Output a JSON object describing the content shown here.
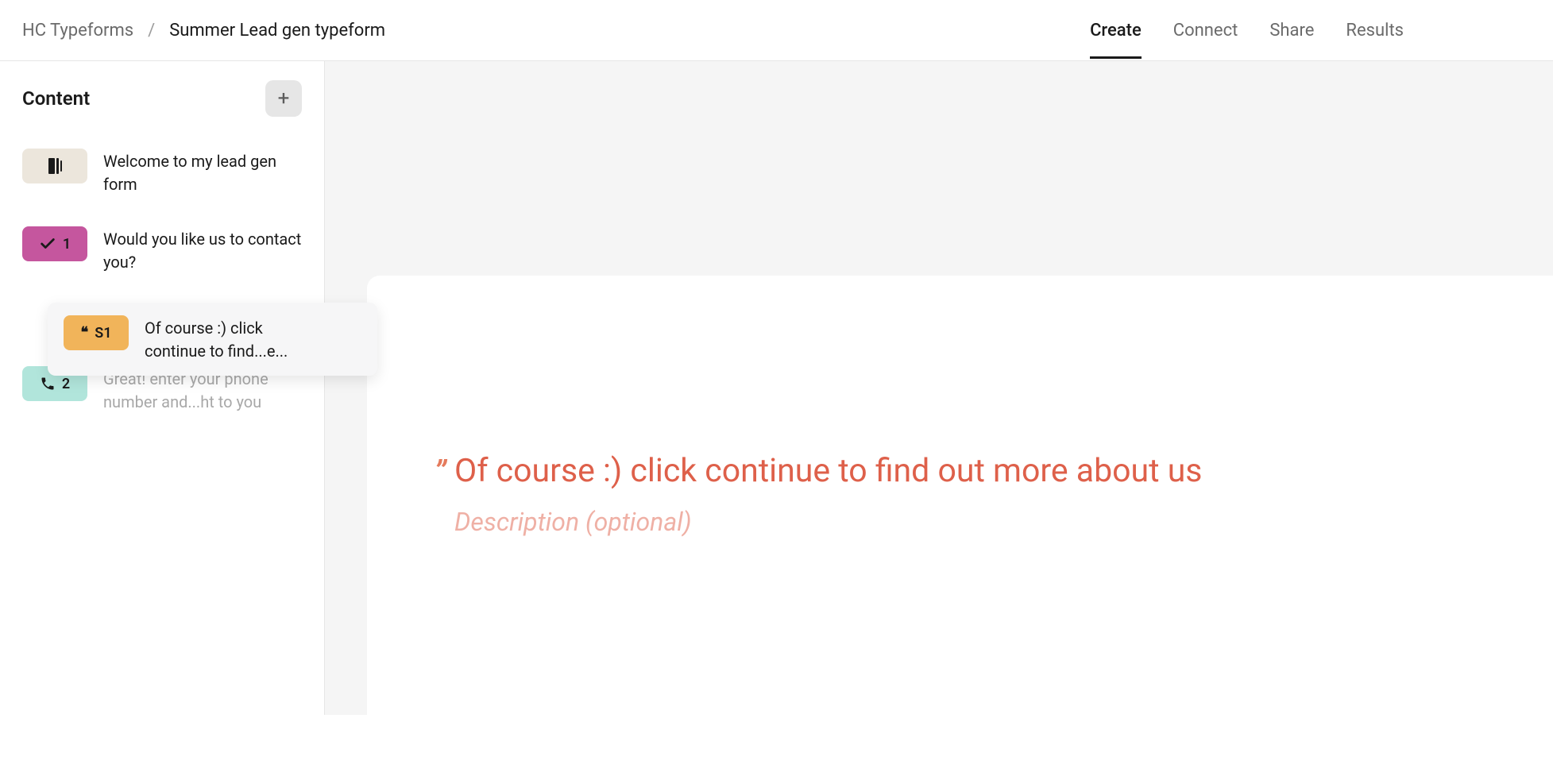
{
  "header": {
    "workspace": "HC Typeforms",
    "separator": "/",
    "form_title": "Summer Lead gen typeform",
    "tabs": {
      "create": "Create",
      "connect": "Connect",
      "share": "Share",
      "results": "Results"
    },
    "active_tab": "create"
  },
  "sidebar": {
    "title": "Content",
    "add_label": "+",
    "items": [
      {
        "type": "welcome",
        "label": "Welcome to my lead gen form",
        "badge_num": ""
      },
      {
        "type": "yesno",
        "label": "Would you like us to contact you?",
        "badge_num": "1"
      },
      {
        "type": "statement",
        "label": "Of course :) click continue to find...e...",
        "badge_num": "S1"
      },
      {
        "type": "phone",
        "label": "Great! enter your phone number and...ht to you",
        "badge_num": "2"
      }
    ]
  },
  "canvas": {
    "statement_text": "Of course :) click continue to find out more about us",
    "description_placeholder": "Description (optional)",
    "quote_glyph": "”"
  },
  "colors": {
    "accent_orange": "#de604a",
    "badge_pink": "#c5569e",
    "badge_orange": "#f1b45a",
    "badge_teal": "#b1e5db",
    "badge_cream": "#ece6dc"
  }
}
